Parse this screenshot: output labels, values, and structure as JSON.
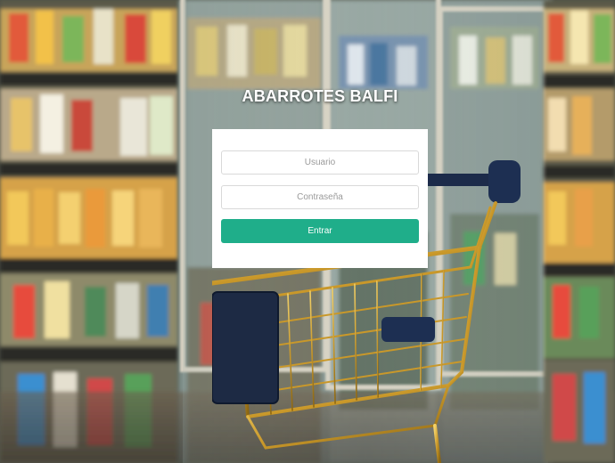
{
  "app": {
    "title": "ABARROTES BALFI"
  },
  "login": {
    "username_placeholder": "Usuario",
    "username_value": "",
    "password_placeholder": "Contraseña",
    "password_value": "",
    "submit_label": "Entrar"
  },
  "colors": {
    "accent": "#1fae8a",
    "panel": "#ffffff",
    "title_text": "#ffffff"
  },
  "icons": {
    "background": "supermarket-aisle-image",
    "cart": "shopping-cart-image"
  }
}
